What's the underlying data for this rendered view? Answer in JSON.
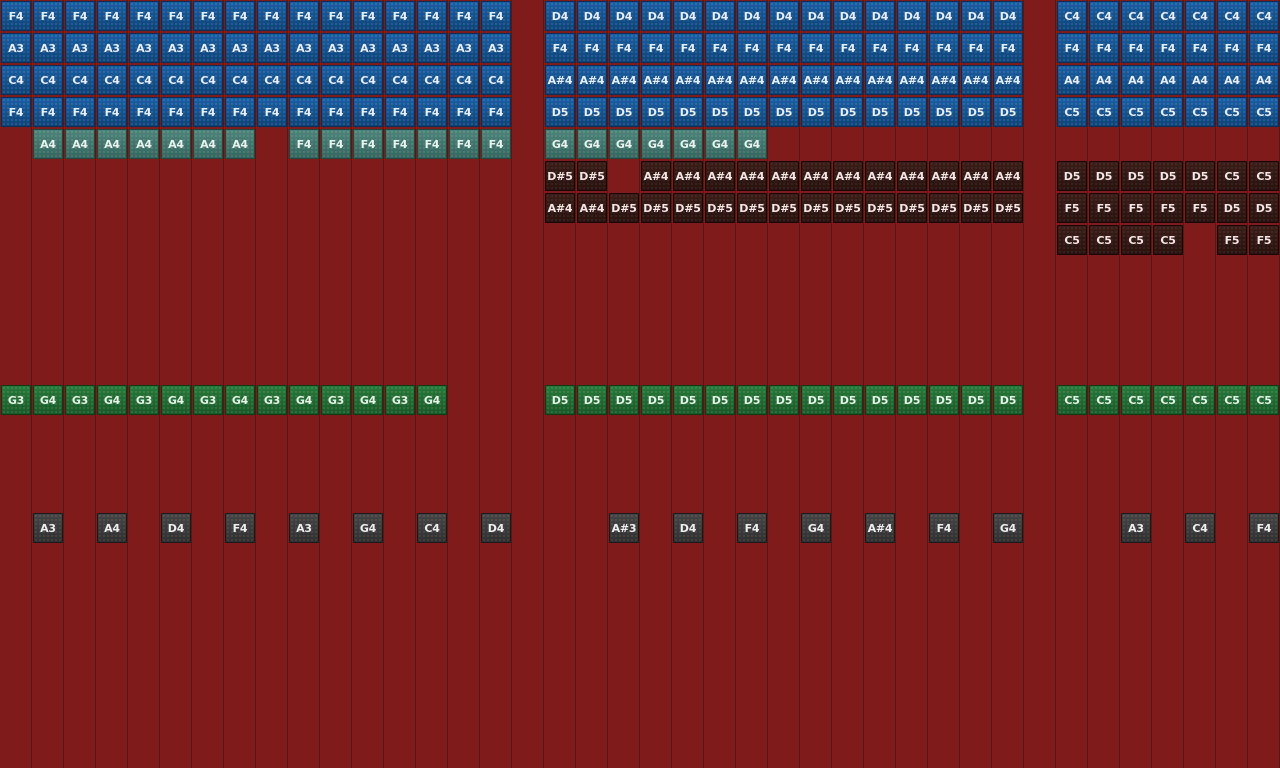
{
  "grid": {
    "background_color": "#7f1b1b",
    "cell": 32,
    "lanes": {
      "blue_top": {
        "color": "#12518f",
        "rows": [
          0,
          1,
          2,
          3
        ]
      },
      "teal": {
        "color": "#3f746b",
        "rows": [
          4
        ]
      },
      "dark": {
        "color": "#2f1612",
        "rows": [
          5,
          6,
          7
        ]
      },
      "green": {
        "color": "#1f6b30",
        "rows": [
          12
        ]
      },
      "gray": {
        "color": "#3a3a3a",
        "rows": [
          16
        ]
      }
    }
  },
  "tracks": [
    {
      "name": "blue-row-1",
      "style": "blue",
      "row": 0,
      "notes": [
        {
          "col": 0,
          "label": "F4"
        },
        {
          "col": 1,
          "label": "F4"
        },
        {
          "col": 2,
          "label": "F4"
        },
        {
          "col": 3,
          "label": "F4"
        },
        {
          "col": 4,
          "label": "F4"
        },
        {
          "col": 5,
          "label": "F4"
        },
        {
          "col": 6,
          "label": "F4"
        },
        {
          "col": 7,
          "label": "F4"
        },
        {
          "col": 8,
          "label": "F4"
        },
        {
          "col": 9,
          "label": "F4"
        },
        {
          "col": 10,
          "label": "F4"
        },
        {
          "col": 11,
          "label": "F4"
        },
        {
          "col": 12,
          "label": "F4"
        },
        {
          "col": 13,
          "label": "F4"
        },
        {
          "col": 14,
          "label": "F4"
        },
        {
          "col": 15,
          "label": "F4"
        },
        {
          "col": 17,
          "label": "D4"
        },
        {
          "col": 18,
          "label": "D4"
        },
        {
          "col": 19,
          "label": "D4"
        },
        {
          "col": 20,
          "label": "D4"
        },
        {
          "col": 21,
          "label": "D4"
        },
        {
          "col": 22,
          "label": "D4"
        },
        {
          "col": 23,
          "label": "D4"
        },
        {
          "col": 24,
          "label": "D4"
        },
        {
          "col": 25,
          "label": "D4"
        },
        {
          "col": 26,
          "label": "D4"
        },
        {
          "col": 27,
          "label": "D4"
        },
        {
          "col": 28,
          "label": "D4"
        },
        {
          "col": 29,
          "label": "D4"
        },
        {
          "col": 30,
          "label": "D4"
        },
        {
          "col": 31,
          "label": "D4"
        },
        {
          "col": 33,
          "label": "C4"
        },
        {
          "col": 34,
          "label": "C4"
        },
        {
          "col": 35,
          "label": "C4"
        },
        {
          "col": 36,
          "label": "C4"
        },
        {
          "col": 37,
          "label": "C4"
        },
        {
          "col": 38,
          "label": "C4"
        },
        {
          "col": 39,
          "label": "C4"
        }
      ]
    },
    {
      "name": "blue-row-2",
      "style": "blue",
      "row": 1,
      "notes": [
        {
          "col": 0,
          "label": "A3"
        },
        {
          "col": 1,
          "label": "A3"
        },
        {
          "col": 2,
          "label": "A3"
        },
        {
          "col": 3,
          "label": "A3"
        },
        {
          "col": 4,
          "label": "A3"
        },
        {
          "col": 5,
          "label": "A3"
        },
        {
          "col": 6,
          "label": "A3"
        },
        {
          "col": 7,
          "label": "A3"
        },
        {
          "col": 8,
          "label": "A3"
        },
        {
          "col": 9,
          "label": "A3"
        },
        {
          "col": 10,
          "label": "A3"
        },
        {
          "col": 11,
          "label": "A3"
        },
        {
          "col": 12,
          "label": "A3"
        },
        {
          "col": 13,
          "label": "A3"
        },
        {
          "col": 14,
          "label": "A3"
        },
        {
          "col": 15,
          "label": "A3"
        },
        {
          "col": 17,
          "label": "F4"
        },
        {
          "col": 18,
          "label": "F4"
        },
        {
          "col": 19,
          "label": "F4"
        },
        {
          "col": 20,
          "label": "F4"
        },
        {
          "col": 21,
          "label": "F4"
        },
        {
          "col": 22,
          "label": "F4"
        },
        {
          "col": 23,
          "label": "F4"
        },
        {
          "col": 24,
          "label": "F4"
        },
        {
          "col": 25,
          "label": "F4"
        },
        {
          "col": 26,
          "label": "F4"
        },
        {
          "col": 27,
          "label": "F4"
        },
        {
          "col": 28,
          "label": "F4"
        },
        {
          "col": 29,
          "label": "F4"
        },
        {
          "col": 30,
          "label": "F4"
        },
        {
          "col": 31,
          "label": "F4"
        },
        {
          "col": 33,
          "label": "F4"
        },
        {
          "col": 34,
          "label": "F4"
        },
        {
          "col": 35,
          "label": "F4"
        },
        {
          "col": 36,
          "label": "F4"
        },
        {
          "col": 37,
          "label": "F4"
        },
        {
          "col": 38,
          "label": "F4"
        },
        {
          "col": 39,
          "label": "F4"
        }
      ]
    },
    {
      "name": "blue-row-3",
      "style": "blue",
      "row": 2,
      "notes": [
        {
          "col": 0,
          "label": "C4"
        },
        {
          "col": 1,
          "label": "C4"
        },
        {
          "col": 2,
          "label": "C4"
        },
        {
          "col": 3,
          "label": "C4"
        },
        {
          "col": 4,
          "label": "C4"
        },
        {
          "col": 5,
          "label": "C4"
        },
        {
          "col": 6,
          "label": "C4"
        },
        {
          "col": 7,
          "label": "C4"
        },
        {
          "col": 8,
          "label": "C4"
        },
        {
          "col": 9,
          "label": "C4"
        },
        {
          "col": 10,
          "label": "C4"
        },
        {
          "col": 11,
          "label": "C4"
        },
        {
          "col": 12,
          "label": "C4"
        },
        {
          "col": 13,
          "label": "C4"
        },
        {
          "col": 14,
          "label": "C4"
        },
        {
          "col": 15,
          "label": "C4"
        },
        {
          "col": 17,
          "label": "A#4"
        },
        {
          "col": 18,
          "label": "A#4"
        },
        {
          "col": 19,
          "label": "A#4"
        },
        {
          "col": 20,
          "label": "A#4"
        },
        {
          "col": 21,
          "label": "A#4"
        },
        {
          "col": 22,
          "label": "A#4"
        },
        {
          "col": 23,
          "label": "A#4"
        },
        {
          "col": 24,
          "label": "A#4"
        },
        {
          "col": 25,
          "label": "A#4"
        },
        {
          "col": 26,
          "label": "A#4"
        },
        {
          "col": 27,
          "label": "A#4"
        },
        {
          "col": 28,
          "label": "A#4"
        },
        {
          "col": 29,
          "label": "A#4"
        },
        {
          "col": 30,
          "label": "A#4"
        },
        {
          "col": 31,
          "label": "A#4"
        },
        {
          "col": 33,
          "label": "A4"
        },
        {
          "col": 34,
          "label": "A4"
        },
        {
          "col": 35,
          "label": "A4"
        },
        {
          "col": 36,
          "label": "A4"
        },
        {
          "col": 37,
          "label": "A4"
        },
        {
          "col": 38,
          "label": "A4"
        },
        {
          "col": 39,
          "label": "A4"
        }
      ]
    },
    {
      "name": "blue-row-4",
      "style": "blue",
      "row": 3,
      "notes": [
        {
          "col": 0,
          "label": "F4"
        },
        {
          "col": 1,
          "label": "F4"
        },
        {
          "col": 2,
          "label": "F4"
        },
        {
          "col": 3,
          "label": "F4"
        },
        {
          "col": 4,
          "label": "F4"
        },
        {
          "col": 5,
          "label": "F4"
        },
        {
          "col": 6,
          "label": "F4"
        },
        {
          "col": 7,
          "label": "F4"
        },
        {
          "col": 8,
          "label": "F4"
        },
        {
          "col": 9,
          "label": "F4"
        },
        {
          "col": 10,
          "label": "F4"
        },
        {
          "col": 11,
          "label": "F4"
        },
        {
          "col": 12,
          "label": "F4"
        },
        {
          "col": 13,
          "label": "F4"
        },
        {
          "col": 14,
          "label": "F4"
        },
        {
          "col": 15,
          "label": "F4"
        },
        {
          "col": 17,
          "label": "D5"
        },
        {
          "col": 18,
          "label": "D5"
        },
        {
          "col": 19,
          "label": "D5"
        },
        {
          "col": 20,
          "label": "D5"
        },
        {
          "col": 21,
          "label": "D5"
        },
        {
          "col": 22,
          "label": "D5"
        },
        {
          "col": 23,
          "label": "D5"
        },
        {
          "col": 24,
          "label": "D5"
        },
        {
          "col": 25,
          "label": "D5"
        },
        {
          "col": 26,
          "label": "D5"
        },
        {
          "col": 27,
          "label": "D5"
        },
        {
          "col": 28,
          "label": "D5"
        },
        {
          "col": 29,
          "label": "D5"
        },
        {
          "col": 30,
          "label": "D5"
        },
        {
          "col": 31,
          "label": "D5"
        },
        {
          "col": 33,
          "label": "C5"
        },
        {
          "col": 34,
          "label": "C5"
        },
        {
          "col": 35,
          "label": "C5"
        },
        {
          "col": 36,
          "label": "C5"
        },
        {
          "col": 37,
          "label": "C5"
        },
        {
          "col": 38,
          "label": "C5"
        },
        {
          "col": 39,
          "label": "C5"
        }
      ]
    },
    {
      "name": "teal-row",
      "style": "teal",
      "row": 4,
      "notes": [
        {
          "col": 1,
          "label": "A4"
        },
        {
          "col": 2,
          "label": "A4"
        },
        {
          "col": 3,
          "label": "A4"
        },
        {
          "col": 4,
          "label": "A4"
        },
        {
          "col": 5,
          "label": "A4"
        },
        {
          "col": 6,
          "label": "A4"
        },
        {
          "col": 7,
          "label": "A4"
        },
        {
          "col": 9,
          "label": "F4"
        },
        {
          "col": 10,
          "label": "F4"
        },
        {
          "col": 11,
          "label": "F4"
        },
        {
          "col": 12,
          "label": "F4"
        },
        {
          "col": 13,
          "label": "F4"
        },
        {
          "col": 14,
          "label": "F4"
        },
        {
          "col": 15,
          "label": "F4"
        },
        {
          "col": 17,
          "label": "G4"
        },
        {
          "col": 18,
          "label": "G4"
        },
        {
          "col": 19,
          "label": "G4"
        },
        {
          "col": 20,
          "label": "G4"
        },
        {
          "col": 21,
          "label": "G4"
        },
        {
          "col": 22,
          "label": "G4"
        },
        {
          "col": 23,
          "label": "G4"
        }
      ]
    },
    {
      "name": "dark-row-1",
      "style": "dark",
      "row": 5,
      "notes": [
        {
          "col": 17,
          "label": "D#5"
        },
        {
          "col": 18,
          "label": "D#5"
        },
        {
          "col": 20,
          "label": "A#4"
        },
        {
          "col": 21,
          "label": "A#4"
        },
        {
          "col": 22,
          "label": "A#4"
        },
        {
          "col": 23,
          "label": "A#4"
        },
        {
          "col": 24,
          "label": "A#4"
        },
        {
          "col": 25,
          "label": "A#4"
        },
        {
          "col": 26,
          "label": "A#4"
        },
        {
          "col": 27,
          "label": "A#4"
        },
        {
          "col": 28,
          "label": "A#4"
        },
        {
          "col": 29,
          "label": "A#4"
        },
        {
          "col": 30,
          "label": "A#4"
        },
        {
          "col": 31,
          "label": "A#4"
        },
        {
          "col": 33,
          "label": "D5"
        },
        {
          "col": 34,
          "label": "D5"
        },
        {
          "col": 35,
          "label": "D5"
        },
        {
          "col": 36,
          "label": "D5"
        },
        {
          "col": 37,
          "label": "D5"
        },
        {
          "col": 38,
          "label": "C5"
        },
        {
          "col": 39,
          "label": "C5"
        }
      ]
    },
    {
      "name": "dark-row-2",
      "style": "dark",
      "row": 6,
      "notes": [
        {
          "col": 17,
          "label": "A#4"
        },
        {
          "col": 18,
          "label": "A#4"
        },
        {
          "col": 19,
          "label": "D#5"
        },
        {
          "col": 20,
          "label": "D#5"
        },
        {
          "col": 21,
          "label": "D#5"
        },
        {
          "col": 22,
          "label": "D#5"
        },
        {
          "col": 23,
          "label": "D#5"
        },
        {
          "col": 24,
          "label": "D#5"
        },
        {
          "col": 25,
          "label": "D#5"
        },
        {
          "col": 26,
          "label": "D#5"
        },
        {
          "col": 27,
          "label": "D#5"
        },
        {
          "col": 28,
          "label": "D#5"
        },
        {
          "col": 29,
          "label": "D#5"
        },
        {
          "col": 30,
          "label": "D#5"
        },
        {
          "col": 31,
          "label": "D#5"
        },
        {
          "col": 33,
          "label": "F5"
        },
        {
          "col": 34,
          "label": "F5"
        },
        {
          "col": 35,
          "label": "F5"
        },
        {
          "col": 36,
          "label": "F5"
        },
        {
          "col": 37,
          "label": "F5"
        },
        {
          "col": 38,
          "label": "D5"
        },
        {
          "col": 39,
          "label": "D5"
        }
      ]
    },
    {
      "name": "dark-row-3",
      "style": "dark",
      "row": 7,
      "notes": [
        {
          "col": 33,
          "label": "C5"
        },
        {
          "col": 34,
          "label": "C5"
        },
        {
          "col": 35,
          "label": "C5"
        },
        {
          "col": 36,
          "label": "C5"
        },
        {
          "col": 38,
          "label": "F5"
        },
        {
          "col": 39,
          "label": "F5"
        }
      ]
    },
    {
      "name": "green-row",
      "style": "green",
      "row": 12,
      "notes": [
        {
          "col": 0,
          "label": "G3"
        },
        {
          "col": 1,
          "label": "G4"
        },
        {
          "col": 2,
          "label": "G3"
        },
        {
          "col": 3,
          "label": "G4"
        },
        {
          "col": 4,
          "label": "G3"
        },
        {
          "col": 5,
          "label": "G4"
        },
        {
          "col": 6,
          "label": "G3"
        },
        {
          "col": 7,
          "label": "G4"
        },
        {
          "col": 8,
          "label": "G3"
        },
        {
          "col": 9,
          "label": "G4"
        },
        {
          "col": 10,
          "label": "G3"
        },
        {
          "col": 11,
          "label": "G4"
        },
        {
          "col": 12,
          "label": "G3"
        },
        {
          "col": 13,
          "label": "G4"
        },
        {
          "col": 17,
          "label": "D5"
        },
        {
          "col": 18,
          "label": "D5"
        },
        {
          "col": 19,
          "label": "D5"
        },
        {
          "col": 20,
          "label": "D5"
        },
        {
          "col": 21,
          "label": "D5"
        },
        {
          "col": 22,
          "label": "D5"
        },
        {
          "col": 23,
          "label": "D5"
        },
        {
          "col": 24,
          "label": "D5"
        },
        {
          "col": 25,
          "label": "D5"
        },
        {
          "col": 26,
          "label": "D5"
        },
        {
          "col": 27,
          "label": "D5"
        },
        {
          "col": 28,
          "label": "D5"
        },
        {
          "col": 29,
          "label": "D5"
        },
        {
          "col": 30,
          "label": "D5"
        },
        {
          "col": 31,
          "label": "D5"
        },
        {
          "col": 33,
          "label": "C5"
        },
        {
          "col": 34,
          "label": "C5"
        },
        {
          "col": 35,
          "label": "C5"
        },
        {
          "col": 36,
          "label": "C5"
        },
        {
          "col": 37,
          "label": "C5"
        },
        {
          "col": 38,
          "label": "C5"
        },
        {
          "col": 39,
          "label": "C5"
        }
      ]
    },
    {
      "name": "gray-row",
      "style": "gray",
      "row": 16,
      "notes": [
        {
          "col": 1,
          "label": "A3"
        },
        {
          "col": 3,
          "label": "A4"
        },
        {
          "col": 5,
          "label": "D4"
        },
        {
          "col": 7,
          "label": "F4"
        },
        {
          "col": 9,
          "label": "A3"
        },
        {
          "col": 11,
          "label": "G4"
        },
        {
          "col": 13,
          "label": "C4"
        },
        {
          "col": 15,
          "label": "D4"
        },
        {
          "col": 19,
          "label": "A#3"
        },
        {
          "col": 21,
          "label": "D4"
        },
        {
          "col": 23,
          "label": "F4"
        },
        {
          "col": 25,
          "label": "G4"
        },
        {
          "col": 27,
          "label": "A#4"
        },
        {
          "col": 29,
          "label": "F4"
        },
        {
          "col": 31,
          "label": "G4"
        },
        {
          "col": 35,
          "label": "A3"
        },
        {
          "col": 37,
          "label": "C4"
        },
        {
          "col": 39,
          "label": "F4"
        }
      ]
    }
  ]
}
